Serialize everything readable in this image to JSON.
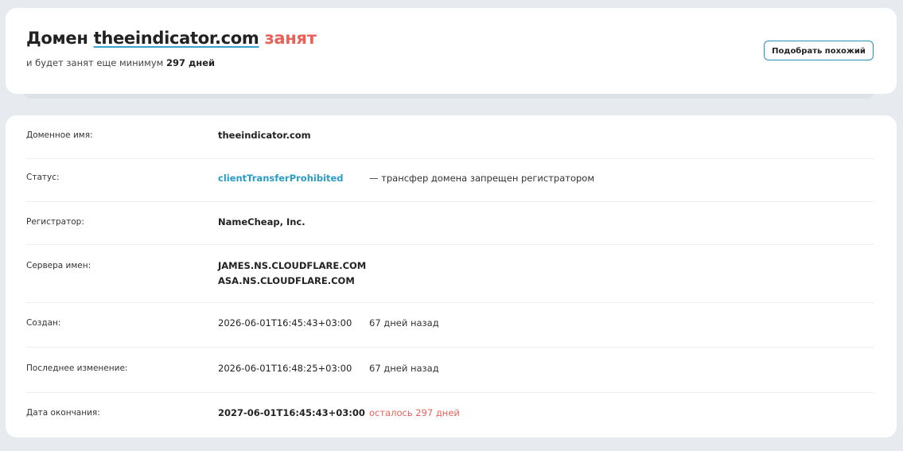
{
  "header": {
    "title_prefix": "Домен",
    "domain": "theeindicator.com",
    "status_word": "занят",
    "subtitle_prefix": "и будет занят еще минимум",
    "subtitle_days": "297 дней",
    "similar_button_label": "Подобрать похожий"
  },
  "info": {
    "rows": [
      {
        "label": "Доменное имя:",
        "value": "theeindicator.com"
      },
      {
        "label": "Статус:",
        "value": "clientTransferProhibited",
        "extra": "— трансфер домена запрещен регистратором"
      },
      {
        "label": "Регистратор:",
        "value": "NameCheap, Inc."
      },
      {
        "label": "Сервера имен:",
        "values": [
          "JAMES.NS.CLOUDFLARE.COM",
          "ASA.NS.CLOUDFLARE.COM"
        ]
      },
      {
        "label": "Создан:",
        "value": "2026-06-01T16:45:43+03:00",
        "extra": "67 дней назад"
      },
      {
        "label": "Последнее изменение:",
        "value": "2026-06-01T16:48:25+03:00",
        "extra": "67 дней назад"
      },
      {
        "label": "Дата окончания:",
        "value": "2027-06-01T16:45:43+03:00",
        "extra": "осталось 297 дней"
      }
    ]
  },
  "colors": {
    "accent": "#2a9bc8",
    "busy": "#e8625a",
    "background": "#e7ebef"
  }
}
